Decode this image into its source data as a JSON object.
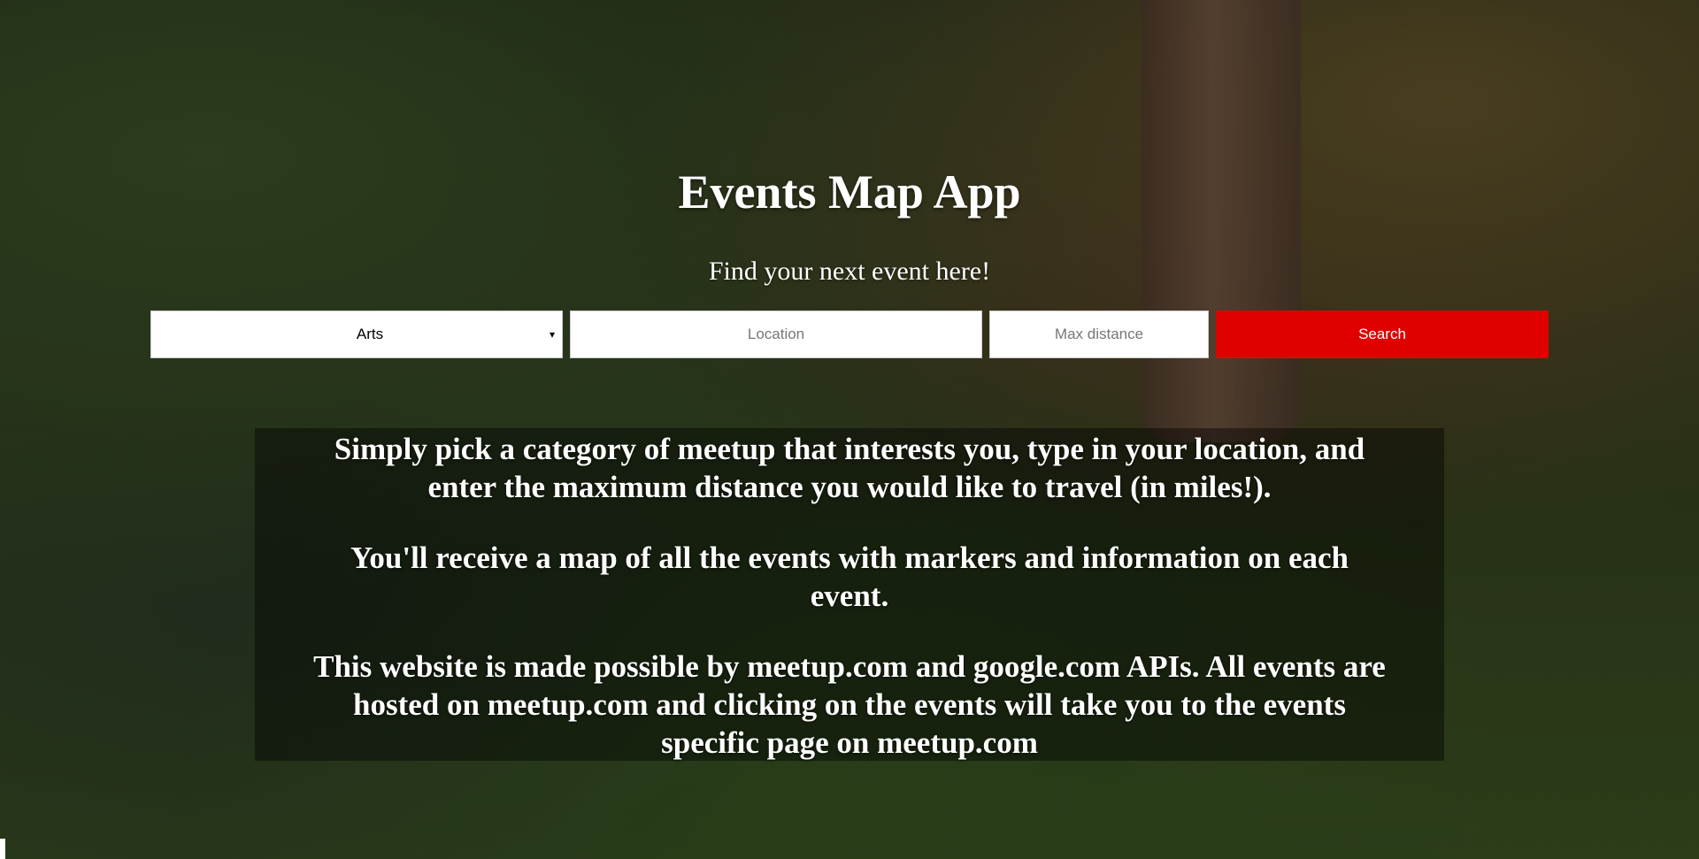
{
  "header": {
    "title": "Events Map App",
    "subtitle": "Find your next event here!"
  },
  "search": {
    "category_selected": "Arts",
    "category_caret": "▾",
    "location_placeholder": "Location",
    "distance_placeholder": "Max distance",
    "search_label": "Search"
  },
  "info": {
    "paragraph_1": "Simply pick a category of meetup that interests you, type in your location, and enter the maximum distance you would like to travel (in miles!).",
    "paragraph_2": "You'll receive a map of all the events with markers and information on each event.",
    "paragraph_3": "This website is made possible by meetup.com and google.com APIs. All events are hosted on meetup.com and clicking on the events will take you to the events specific page on meetup.com"
  },
  "colors": {
    "accent": "#e00000",
    "text": "#ffffff"
  }
}
